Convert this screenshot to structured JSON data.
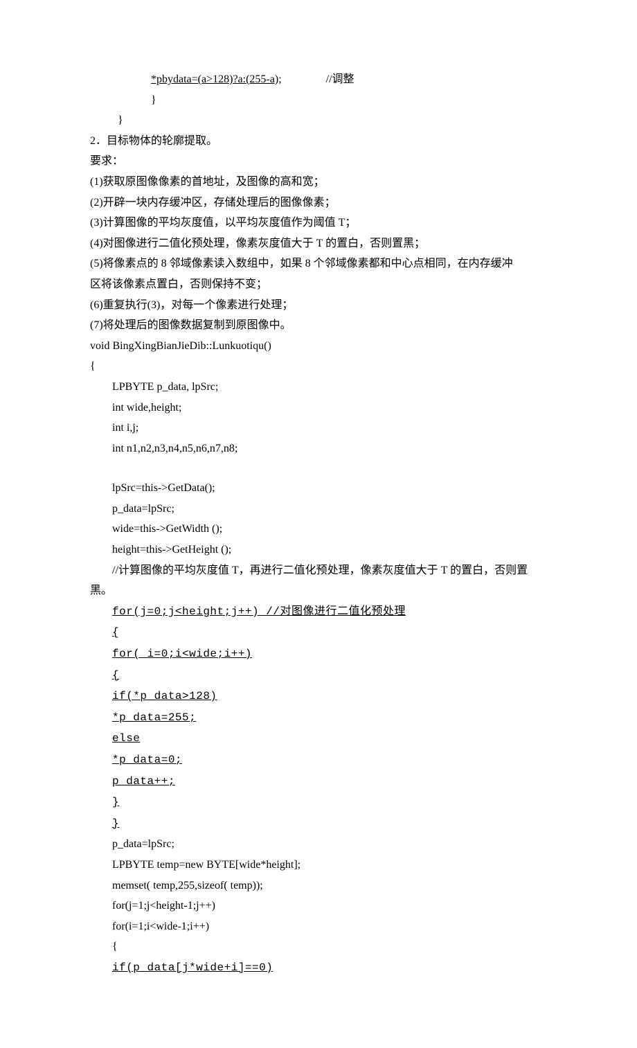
{
  "lines": {
    "l1a": "*pbydata=(a>128)?a:(255-a);",
    "l1b": "//调整",
    "l2": "}",
    "l3": "}",
    "l4": "2．目标物体的轮廓提取。",
    "l5": "要求：",
    "l6": "(1)获取原图像像素的首地址，及图像的高和宽；",
    "l7": "(2)开辟一块内存缓冲区，存储处理后的图像像素；",
    "l8": "(3)计算图像的平均灰度值，以平均灰度值作为阈值 T；",
    "l9": "(4)对图像进行二值化预处理，像素灰度值大于 T 的置白，否则置黑；",
    "l10": "(5)将像素点的 8 邻域像素读入数组中，如果 8 个邻域像素都和中心点相同，在内存缓冲",
    "l11": "区将该像素点置白，否则保持不变；",
    "l12": "(6)重复执行(3)，对每一个像素进行处理；",
    "l13": "(7)将处理后的图像数据复制到原图像中。",
    "l14": "void BingXingBianJieDib::Lunkuotiqu()",
    "l15": "{",
    "l16": "LPBYTE    p_data, lpSrc;",
    "l17": "int wide,height;",
    "l18": "int i,j;",
    "l19": "int n1,n2,n3,n4,n5,n6,n7,n8;",
    "l20": "lpSrc=this->GetData();",
    "l21": "p_data=lpSrc;",
    "l22": "wide=this->GetWidth ();",
    "l23": "height=this->GetHeight ();",
    "l24": " //计算图像的平均灰度值 T，再进行二值化预处理，像素灰度值大于 T 的置白，否则置",
    "l25": "黑。",
    "l26": "for(j=0;j<height;j++)   //对图像进行二值化预处理",
    "l27": " {",
    "l28": "    for( i=0;i<wide;i++)",
    "l29": "    {",
    "l30": "        if(*p_data>128)",
    "l31": "            *p_data=255;",
    "l32": "        else",
    "l33": "            *p_data=0; ",
    "l34": "        p_data++;",
    "l35": "    }",
    "l36": "} ",
    "l37": " p_data=lpSrc;",
    "l38": " LPBYTE     temp=new BYTE[wide*height];",
    "l39": " memset( temp,255,sizeof( temp));",
    "l40": " for(j=1;j<height-1;j++)",
    "l41": " for(i=1;i<wide-1;i++)",
    "l42": " {",
    "l43": " if(p_data[j*wide+i]==0)"
  }
}
